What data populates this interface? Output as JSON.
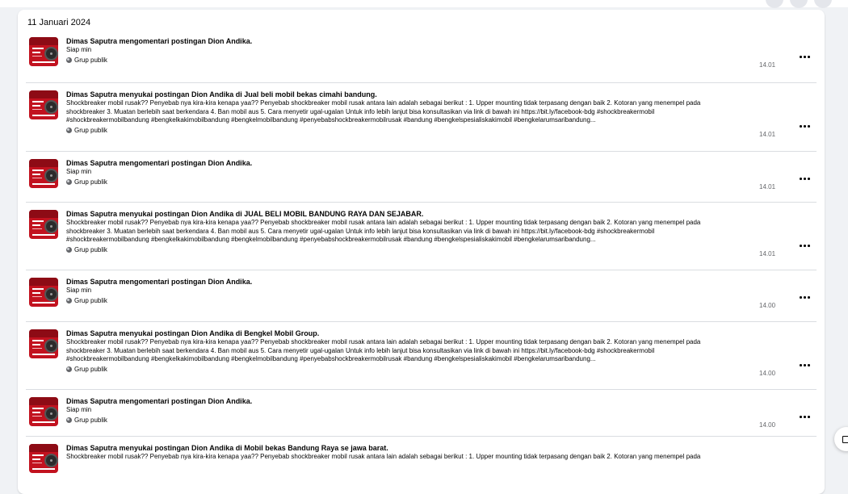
{
  "date_heading": "11 Januari 2024",
  "visibility_label": "Grup publik",
  "comment_text": "Siap min",
  "items": [
    {
      "title": "Dimas Saputra mengomentari postingan Dion Andika.",
      "snippet_lines": [
        "Siap min"
      ],
      "time": "14.01"
    },
    {
      "title": "Dimas Saputra menyukai postingan Dion Andika di Jual beli mobil bekas cimahi bandung.",
      "snippet_lines": [
        "Shockbreaker mobil rusak?? Penyebab nya kira-kira kenapa yaa?? Penyebab shockbreaker mobil rusak antara lain adalah sebagai berikut : 1. Upper mounting tidak terpasang dengan baik 2. Kotoran yang menempel pada",
        "shockbreaker 3. Muatan berlebih saat berkendara 4. Ban mobil aus 5. Cara menyetir ugal-ugalan Untuk info lebih lanjut bisa konsultasikan via link di bawah ini https://bit.ly/facebook-bdg #shockbreakermobil",
        "#shockbreakermobilbandung #bengkelkakimobilbandung #bengkelmobilbandung #penyebabshockbreakermobilrusak #bandung #bengkelspesialiskakimobil #bengkelarumsaribandung..."
      ],
      "time": "14.01"
    },
    {
      "title": "Dimas Saputra mengomentari postingan Dion Andika.",
      "snippet_lines": [
        "Siap min"
      ],
      "time": "14.01"
    },
    {
      "title": "Dimas Saputra menyukai postingan Dion Andika di JUAL BELI MOBIL BANDUNG RAYA DAN SEJABAR.",
      "snippet_lines": [
        "Shockbreaker mobil rusak?? Penyebab nya kira-kira kenapa yaa?? Penyebab shockbreaker mobil rusak antara lain adalah sebagai berikut : 1. Upper mounting tidak terpasang dengan baik 2. Kotoran yang menempel pada",
        "shockbreaker 3. Muatan berlebih saat berkendara 4. Ban mobil aus 5. Cara menyetir ugal-ugalan Untuk info lebih lanjut bisa konsultasikan via link di bawah ini https://bit.ly/facebook-bdg #shockbreakermobil",
        "#shockbreakermobilbandung #bengkelkakimobilbandung #bengkelmobilbandung #penyebabshockbreakermobilrusak #bandung #bengkelspesialiskakimobil #bengkelarumsaribandung..."
      ],
      "time": "14.01"
    },
    {
      "title": "Dimas Saputra mengomentari postingan Dion Andika.",
      "snippet_lines": [
        "Siap min"
      ],
      "time": "14.00"
    },
    {
      "title": "Dimas Saputra menyukai postingan Dion Andika di Bengkel Mobil Group.",
      "snippet_lines": [
        "Shockbreaker mobil rusak?? Penyebab nya kira-kira kenapa yaa?? Penyebab shockbreaker mobil rusak antara lain adalah sebagai berikut : 1. Upper mounting tidak terpasang dengan baik 2. Kotoran yang menempel pada",
        "shockbreaker 3. Muatan berlebih saat berkendara 4. Ban mobil aus 5. Cara menyetir ugal-ugalan Untuk info lebih lanjut bisa konsultasikan via link di bawah ini https://bit.ly/facebook-bdg #shockbreakermobil",
        "#shockbreakermobilbandung #bengkelkakimobilbandung #bengkelmobilbandung #penyebabshockbreakermobilrusak #bandung #bengkelspesialiskakimobil #bengkelarumsaribandung..."
      ],
      "time": "14.00"
    },
    {
      "title": "Dimas Saputra mengomentari postingan Dion Andika.",
      "snippet_lines": [
        "Siap min"
      ],
      "time": "14.00"
    },
    {
      "title": "Dimas Saputra menyukai postingan Dion Andika di Mobil bekas Bandung Raya se jawa barat.",
      "snippet_lines": [
        "Shockbreaker mobil rusak?? Penyebab nya kira-kira kenapa yaa?? Penyebab shockbreaker mobil rusak antara lain adalah sebagai berikut : 1. Upper mounting tidak terpasang dengan baik 2. Kotoran yang menempel pada"
      ],
      "time": ""
    }
  ]
}
